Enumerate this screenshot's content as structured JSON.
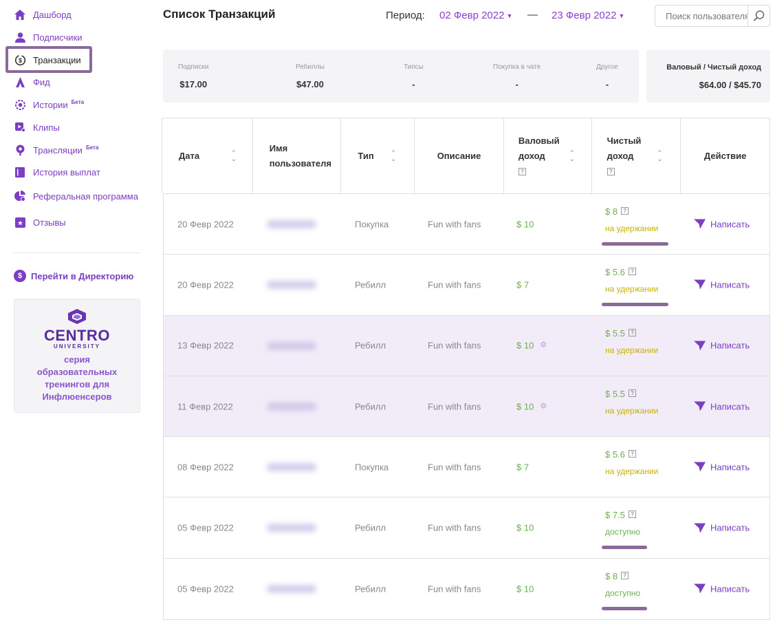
{
  "sidebar": {
    "items": [
      {
        "label": "Дашборд",
        "icon": "home-icon"
      },
      {
        "label": "Подписчики",
        "icon": "user-icon"
      },
      {
        "label": "Транзакции",
        "icon": "dollar-cycle-icon"
      },
      {
        "label": "Фид",
        "icon": "feed-icon"
      },
      {
        "label": "Истории",
        "icon": "stories-icon",
        "badge": "Бета"
      },
      {
        "label": "Клипы",
        "icon": "clips-icon"
      },
      {
        "label": "Трансляции",
        "icon": "broadcast-icon",
        "badge": "Бета"
      },
      {
        "label": "История выплат",
        "icon": "payout-history-icon"
      },
      {
        "label": "Реферальная программа",
        "icon": "referral-icon"
      },
      {
        "label": "Отзывы",
        "icon": "reviews-icon"
      }
    ],
    "active_index": 2,
    "directory_link": "Перейти в Директорию",
    "promo": {
      "brand": "CENTRO",
      "sub": "UNIVERSITY",
      "description": [
        "серия",
        "образовательных",
        "тренингов для",
        "Инфлюенсеров"
      ]
    }
  },
  "header": {
    "title": "Список Транзакций",
    "period_label": "Период:",
    "date_from": "02 Февр 2022",
    "date_to": "23 Февр 2022",
    "dash": "—",
    "search_placeholder": "Поиск пользователя"
  },
  "summary": {
    "columns": [
      {
        "label": "Подписки",
        "value": "$17.00"
      },
      {
        "label": "Ребиллы",
        "value": "$47.00"
      },
      {
        "label": "Типсы",
        "value": "-"
      },
      {
        "label": "Покупка в чате",
        "value": "-"
      },
      {
        "label": "Другое",
        "value": "-"
      }
    ],
    "total_label": "Валовый / Чистый доход",
    "total_value": "$64.00 / $45.70"
  },
  "table": {
    "headers": {
      "date": "Дата",
      "user": [
        "Имя",
        "пользователя"
      ],
      "type": "Тип",
      "desc": "Описание",
      "gross": [
        "Валовый",
        "доход"
      ],
      "net": [
        "Чистый",
        "доход"
      ],
      "action": "Действие"
    },
    "action_label": "Написать",
    "rows": [
      {
        "date": "20 Февр 2022",
        "type": "Покупка",
        "desc": "Fun with fans",
        "gross": "$ 10",
        "net": "$ 8",
        "status": "на удержании",
        "status_kind": "hold",
        "highlight": false,
        "gross_icon": false,
        "underlined": true
      },
      {
        "date": "20 Февр 2022",
        "type": "Ребилл",
        "desc": "Fun with fans",
        "gross": "$ 7",
        "net": "$ 5.6",
        "status": "на удержании",
        "status_kind": "hold",
        "highlight": false,
        "gross_icon": false,
        "underlined": true
      },
      {
        "date": "13 Февр 2022",
        "type": "Ребилл",
        "desc": "Fun with fans",
        "gross": "$ 10",
        "net": "$ 5.5",
        "status": "на удержании",
        "status_kind": "hold",
        "highlight": true,
        "gross_icon": true,
        "underlined": false
      },
      {
        "date": "11 Февр 2022",
        "type": "Ребилл",
        "desc": "Fun with fans",
        "gross": "$ 10",
        "net": "$ 5.5",
        "status": "на удержании",
        "status_kind": "hold",
        "highlight": true,
        "gross_icon": true,
        "underlined": false
      },
      {
        "date": "08 Февр 2022",
        "type": "Покупка",
        "desc": "Fun with fans",
        "gross": "$ 7",
        "net": "$ 5.6",
        "status": "на удержании",
        "status_kind": "hold",
        "highlight": false,
        "gross_icon": false,
        "underlined": false
      },
      {
        "date": "05 Февр 2022",
        "type": "Ребилл",
        "desc": "Fun with fans",
        "gross": "$ 10",
        "net": "$ 7.5",
        "status": "доступно",
        "status_kind": "avail",
        "highlight": false,
        "gross_icon": false,
        "underlined": true
      },
      {
        "date": "05 Февр 2022",
        "type": "Ребилл",
        "desc": "Fun with fans",
        "gross": "$ 10",
        "net": "$ 8",
        "status": "доступно",
        "status_kind": "avail",
        "highlight": false,
        "gross_icon": false,
        "underlined": true
      }
    ]
  },
  "colors": {
    "accent": "#7a3fc2",
    "positive": "#6ab04c",
    "hold": "#c9b200",
    "highlight_row": "#f2ecf9"
  }
}
